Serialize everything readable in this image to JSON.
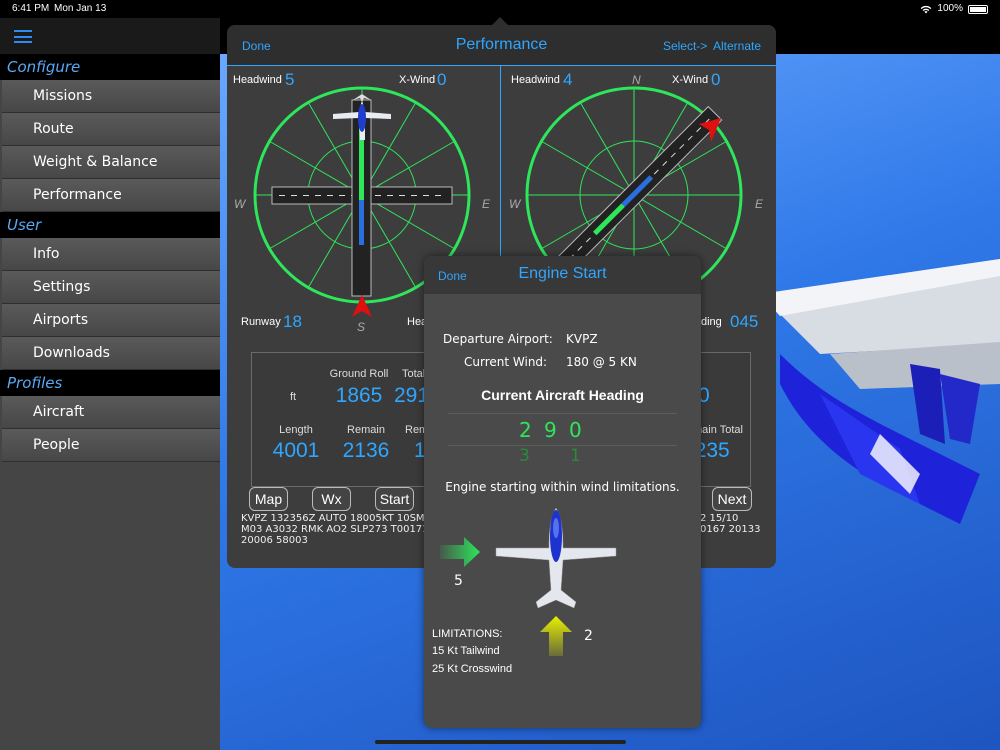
{
  "status": {
    "time": "6:41 PM",
    "date": "Mon Jan 13",
    "battery": "100%"
  },
  "sidebar": {
    "sections": [
      {
        "title": "Configure",
        "items": [
          "Missions",
          "Route",
          "Weight & Balance",
          "Performance"
        ]
      },
      {
        "title": "User",
        "items": [
          "Info",
          "Settings",
          "Airports",
          "Downloads"
        ]
      },
      {
        "title": "Profiles",
        "items": [
          "Aircraft",
          "People"
        ]
      }
    ]
  },
  "performance": {
    "done": "Done",
    "title": "Performance",
    "select": "Select->",
    "alternate": "Alternate",
    "left": {
      "headwind_label": "Headwind",
      "headwind": "5",
      "xwind_label": "X-Wind",
      "xwind": "0",
      "runway_label": "Runway",
      "runway": "18",
      "heading_label": "Hea",
      "compass": {
        "w": "W",
        "e": "E",
        "s": "S"
      }
    },
    "right": {
      "headwind_label": "Headwind",
      "headwind": "4",
      "xwind_label": "X-Wind",
      "xwind": "0",
      "heading_label": "ding",
      "heading": "045",
      "compass": {
        "n": "N",
        "w": "W",
        "e": "E"
      }
    },
    "stats": {
      "ground_roll_label": "Ground Roll",
      "ground_roll": "1865",
      "unit": "ft",
      "total_label": "Total",
      "total_partial": "291",
      "length_label": "Length",
      "length": "4001",
      "remain_label": "Remain",
      "remain": "2136",
      "rem_label": "Rem",
      "rem_partial": "1",
      "right_top_partial": "0",
      "remain_total_label": "main Total",
      "remain_total_partial": "3235"
    },
    "buttons": {
      "map": "Map",
      "wx": "Wx",
      "start": "Start",
      "next": "Next"
    },
    "metar_left": "KVPZ 132356Z AUTO 18005KT 10SM C\nM03 A3032 RMK AO2 SLP273 T001710\n20006 58003",
    "metar_right": "2 15/10\n0167 20133"
  },
  "engine": {
    "done": "Done",
    "title": "Engine Start",
    "departure_label": "Departure Airport:",
    "departure": "KVPZ",
    "wind_label": "Current Wind:",
    "wind": "180 @ 5 KN",
    "heading_title": "Current Aircraft Heading",
    "heading_digits": [
      "2",
      "9",
      "0"
    ],
    "heading_next": [
      "3",
      "",
      "1"
    ],
    "message": "Engine starting within wind limitations.",
    "crosswind_value": "5",
    "tailwind_value": "2",
    "limitations_title": "LIMITATIONS:",
    "limit_tail": "15 Kt Tailwind",
    "limit_cross": "25 Kt Crosswind"
  },
  "colors": {
    "accent": "#2fa6ff",
    "compass": "#2ee65a",
    "arrow": "#e8f000",
    "marker": "#e01010"
  }
}
